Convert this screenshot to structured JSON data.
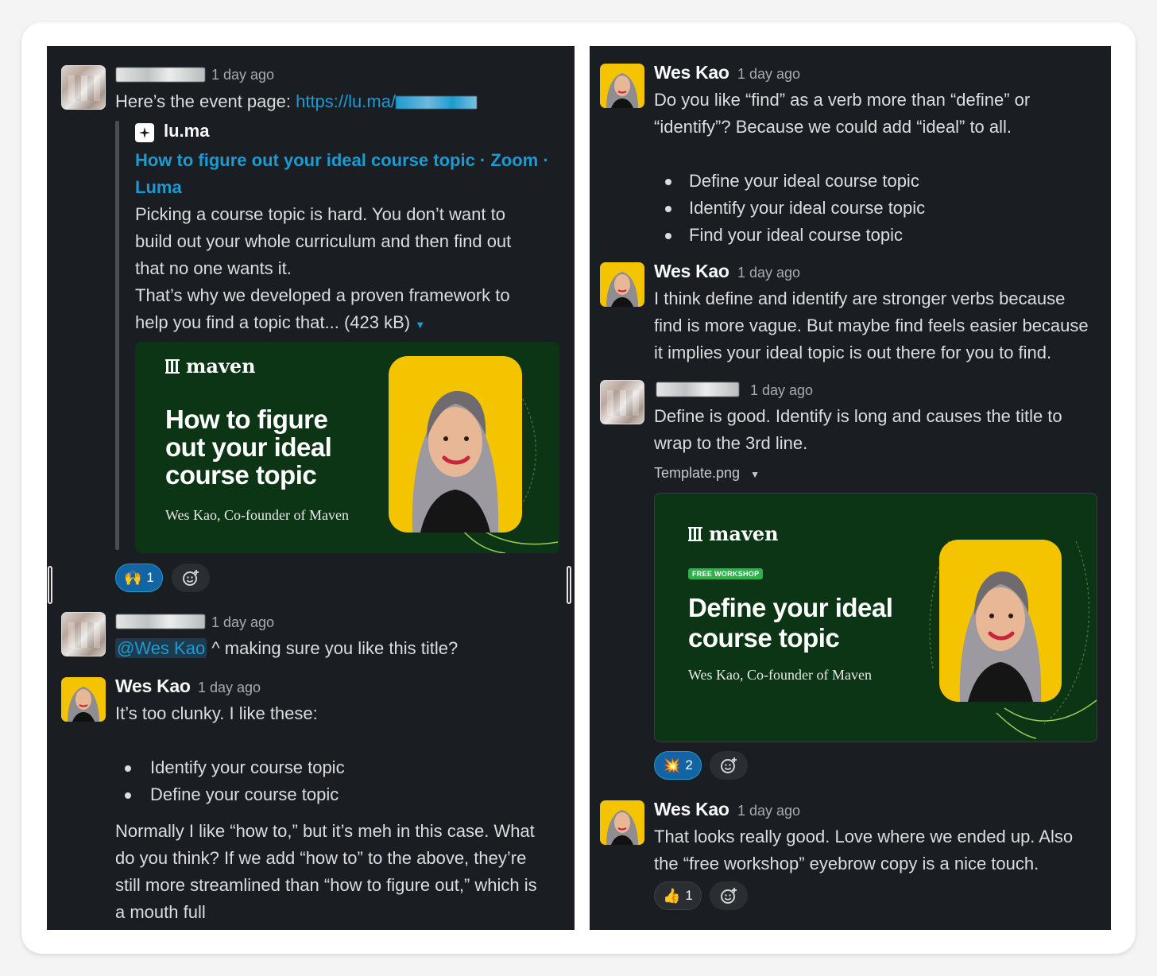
{
  "left": {
    "msg1": {
      "time": "1 day ago",
      "text_prefix": "Here’s the event page: ",
      "link": "https://lu.ma/",
      "unfurl": {
        "site": "lu.ma",
        "title_line1": "How to figure out your ideal course topic · Zoom ·",
        "title_line2": "Luma",
        "desc_lines": [
          "Picking a course topic is hard. You don’t want to",
          "build out your whole curriculum and then find out",
          "that no one wants it.",
          "That’s why we developed a proven framework to",
          "help you find a topic that... (423 kB)"
        ],
        "card": {
          "logo": "maven",
          "title_lines": [
            "How to figure",
            "out your ideal",
            "course topic"
          ],
          "byline": "Wes Kao, Co-founder of Maven"
        }
      },
      "reaction": {
        "emoji": "🙌",
        "count": "1"
      }
    },
    "msg2": {
      "time": "1 day ago",
      "mention": "@Wes Kao",
      "text": " ^ making sure you like this title?"
    },
    "msg3": {
      "name": "Wes Kao",
      "time": "1 day ago",
      "text": "It’s too clunky. I like these:",
      "bullets": [
        "Identify your course topic",
        "Define your course topic"
      ],
      "para_lines": [
        "Normally I like “how to,” but it’s meh in this case. What",
        "do you think? If we add “how to” to the above, they’re",
        "still more streamlined than “how to figure out,” which is",
        "a mouth full"
      ]
    }
  },
  "right": {
    "msg1": {
      "name": "Wes Kao",
      "time": "1 day ago",
      "lines": [
        "Do you like “find” as a verb more than “define” or",
        "“identify”? Because we could add “ideal” to all."
      ],
      "bullets": [
        "Define your ideal course topic",
        "Identify your ideal course topic",
        "Find your ideal course topic"
      ]
    },
    "msg2": {
      "name": "Wes Kao",
      "time": "1 day ago",
      "lines": [
        "I think define and identify are stronger verbs because",
        "find is more vague. But maybe find feels easier because",
        "it implies your ideal topic is out there for you to find."
      ]
    },
    "msg3": {
      "time": "1 day ago",
      "lines": [
        "Define is good. Identify is long and causes the title to",
        "wrap to the 3rd line."
      ],
      "file_name": "Template.png",
      "card": {
        "logo": "maven",
        "badge": "FREE WORKSHOP",
        "title_lines": [
          "Define your ideal",
          "course topic"
        ],
        "byline": "Wes Kao, Co-founder of Maven"
      },
      "reaction": {
        "emoji": "💥",
        "count": "2"
      }
    },
    "msg4": {
      "name": "Wes Kao",
      "time": "1 day ago",
      "lines": [
        "That looks really good. Love where we ended up. Also",
        "the “free workshop” eyebrow copy is a nice touch."
      ],
      "reaction": {
        "emoji": "👍",
        "count": "1"
      }
    }
  },
  "icons": {
    "add_reaction": "add-reaction-icon",
    "dropdown": "caret-down-icon",
    "site_favicon": "luma-favicon-icon"
  },
  "colors": {
    "panel_bg": "#1a1d21",
    "link": "#1d9bd1",
    "promo_bg": "#0c3515",
    "photo_bg": "#f5c400",
    "badge_green": "#29b34a"
  }
}
